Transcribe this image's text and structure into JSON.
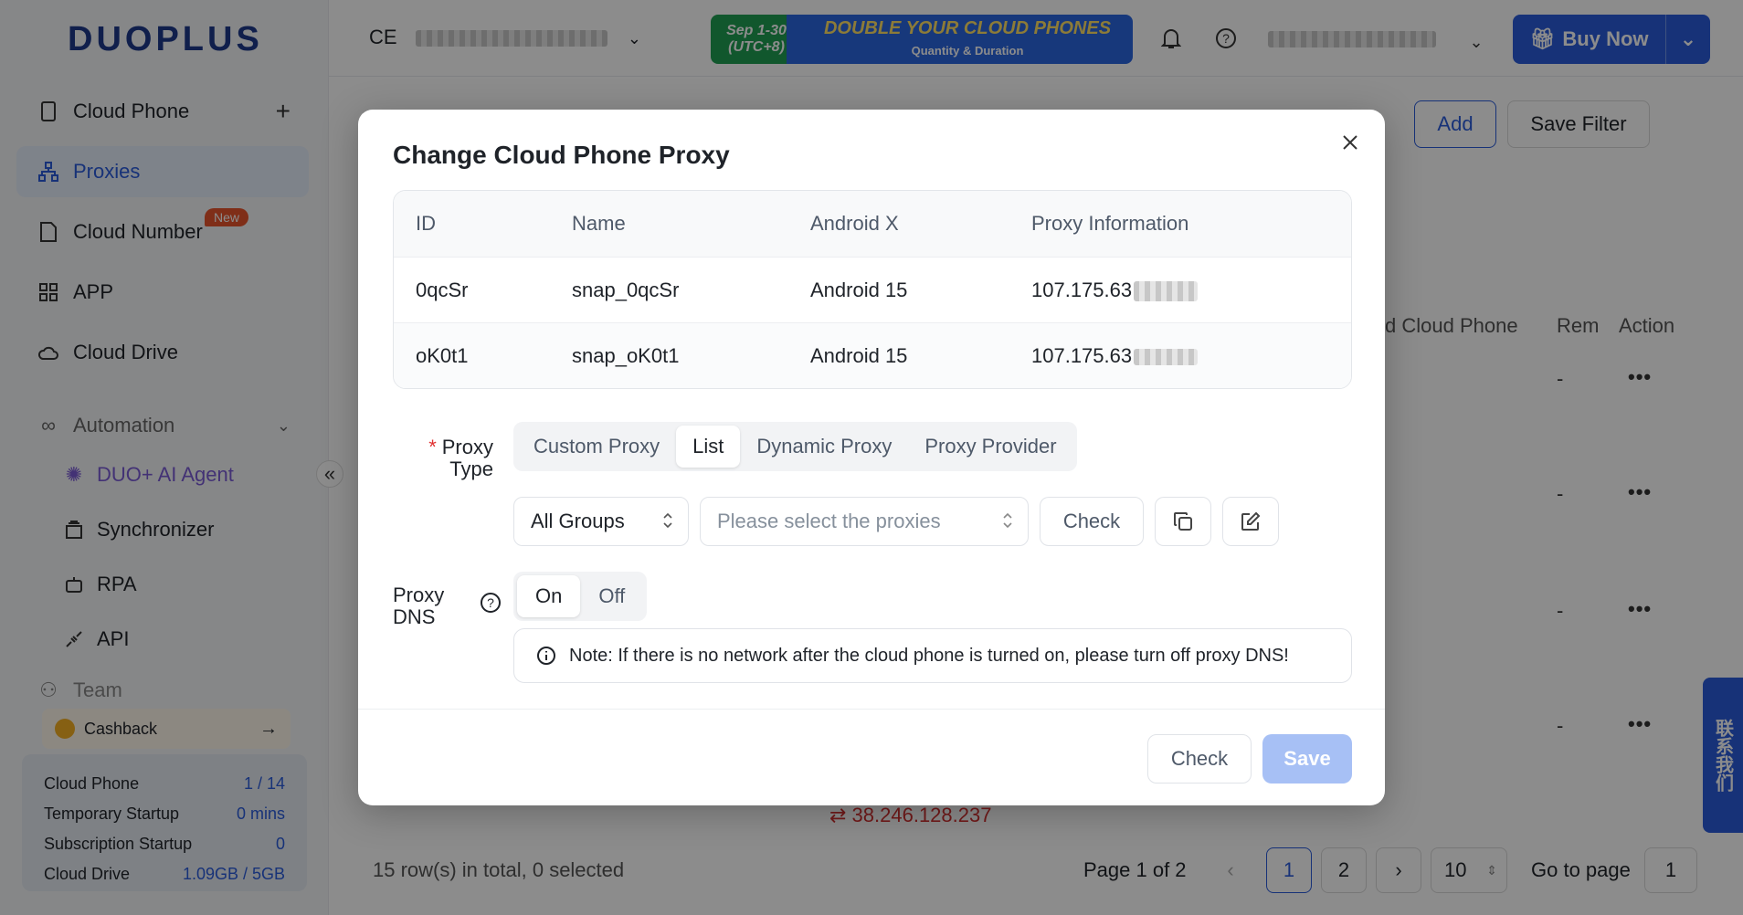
{
  "app": {
    "logo": "DUOPLUS"
  },
  "sidebar": {
    "items": [
      {
        "label": "Cloud Phone"
      },
      {
        "label": "Proxies"
      },
      {
        "label": "Cloud Number",
        "badge": "New"
      },
      {
        "label": "APP"
      },
      {
        "label": "Cloud Drive"
      },
      {
        "label": "Automation"
      }
    ],
    "sub_items": [
      {
        "label": "DUO+ AI Agent"
      },
      {
        "label": "Synchronizer"
      },
      {
        "label": "RPA"
      },
      {
        "label": "API"
      }
    ],
    "team_label": "Team",
    "cashback_label": "Cashback",
    "stats": [
      {
        "label": "Cloud Phone",
        "value": "1 / 14"
      },
      {
        "label": "Temporary Startup",
        "value": "0 mins"
      },
      {
        "label": "Subscription Startup",
        "value": "0"
      },
      {
        "label": "Cloud Drive",
        "value": "1.09GB / 5GB"
      }
    ]
  },
  "topbar": {
    "account_prefix": "CE",
    "promo_dates": "Sep 1-30 (UTC+8)",
    "promo_text": "DOUBLE YOUR CLOUD PHONES",
    "promo_sub": "Quantity & Duration",
    "buy_label": "Buy Now"
  },
  "background": {
    "add_label": "Add",
    "save_filter_label": "Save Filter",
    "col_cloud_phone": "d Cloud Phone",
    "col_rem": "Rem",
    "col_action": "Action",
    "dash": "-",
    "dots": "•••",
    "ip_text": "38.246.128.237",
    "rows_summary": "15 row(s) in total, 0 selected",
    "page_info": "Page 1 of 2",
    "pages": [
      "1",
      "2"
    ],
    "page_size": "10",
    "goto_label": "Go to page",
    "goto_value": "1",
    "contact_label": "联系我们"
  },
  "modal": {
    "title": "Change Cloud Phone Proxy",
    "table": {
      "headers": [
        "ID",
        "Name",
        "Android X",
        "Proxy Information"
      ],
      "rows": [
        {
          "id": "0qcSr",
          "name": "snap_0qcSr",
          "android": "Android 15",
          "proxy": "107.175.63"
        },
        {
          "id": "oK0t1",
          "name": "snap_oK0t1",
          "android": "Android 15",
          "proxy": "107.175.63"
        }
      ]
    },
    "proxy_type": {
      "label_line1": "Proxy",
      "label_line2": "Type",
      "required_mark": "*",
      "options": [
        "Custom Proxy",
        "List",
        "Dynamic Proxy",
        "Proxy Provider"
      ],
      "selected": "List"
    },
    "group_select": "All Groups",
    "proxy_select_placeholder": "Please select the proxies",
    "check_label": "Check",
    "proxy_dns": {
      "label_line1": "Proxy",
      "label_line2": "DNS",
      "on": "On",
      "off": "Off",
      "selected": "On"
    },
    "note": "Note: If there is no network after the cloud phone is turned on, please turn off proxy DNS!",
    "footer": {
      "check_label": "Check",
      "save_label": "Save"
    }
  }
}
